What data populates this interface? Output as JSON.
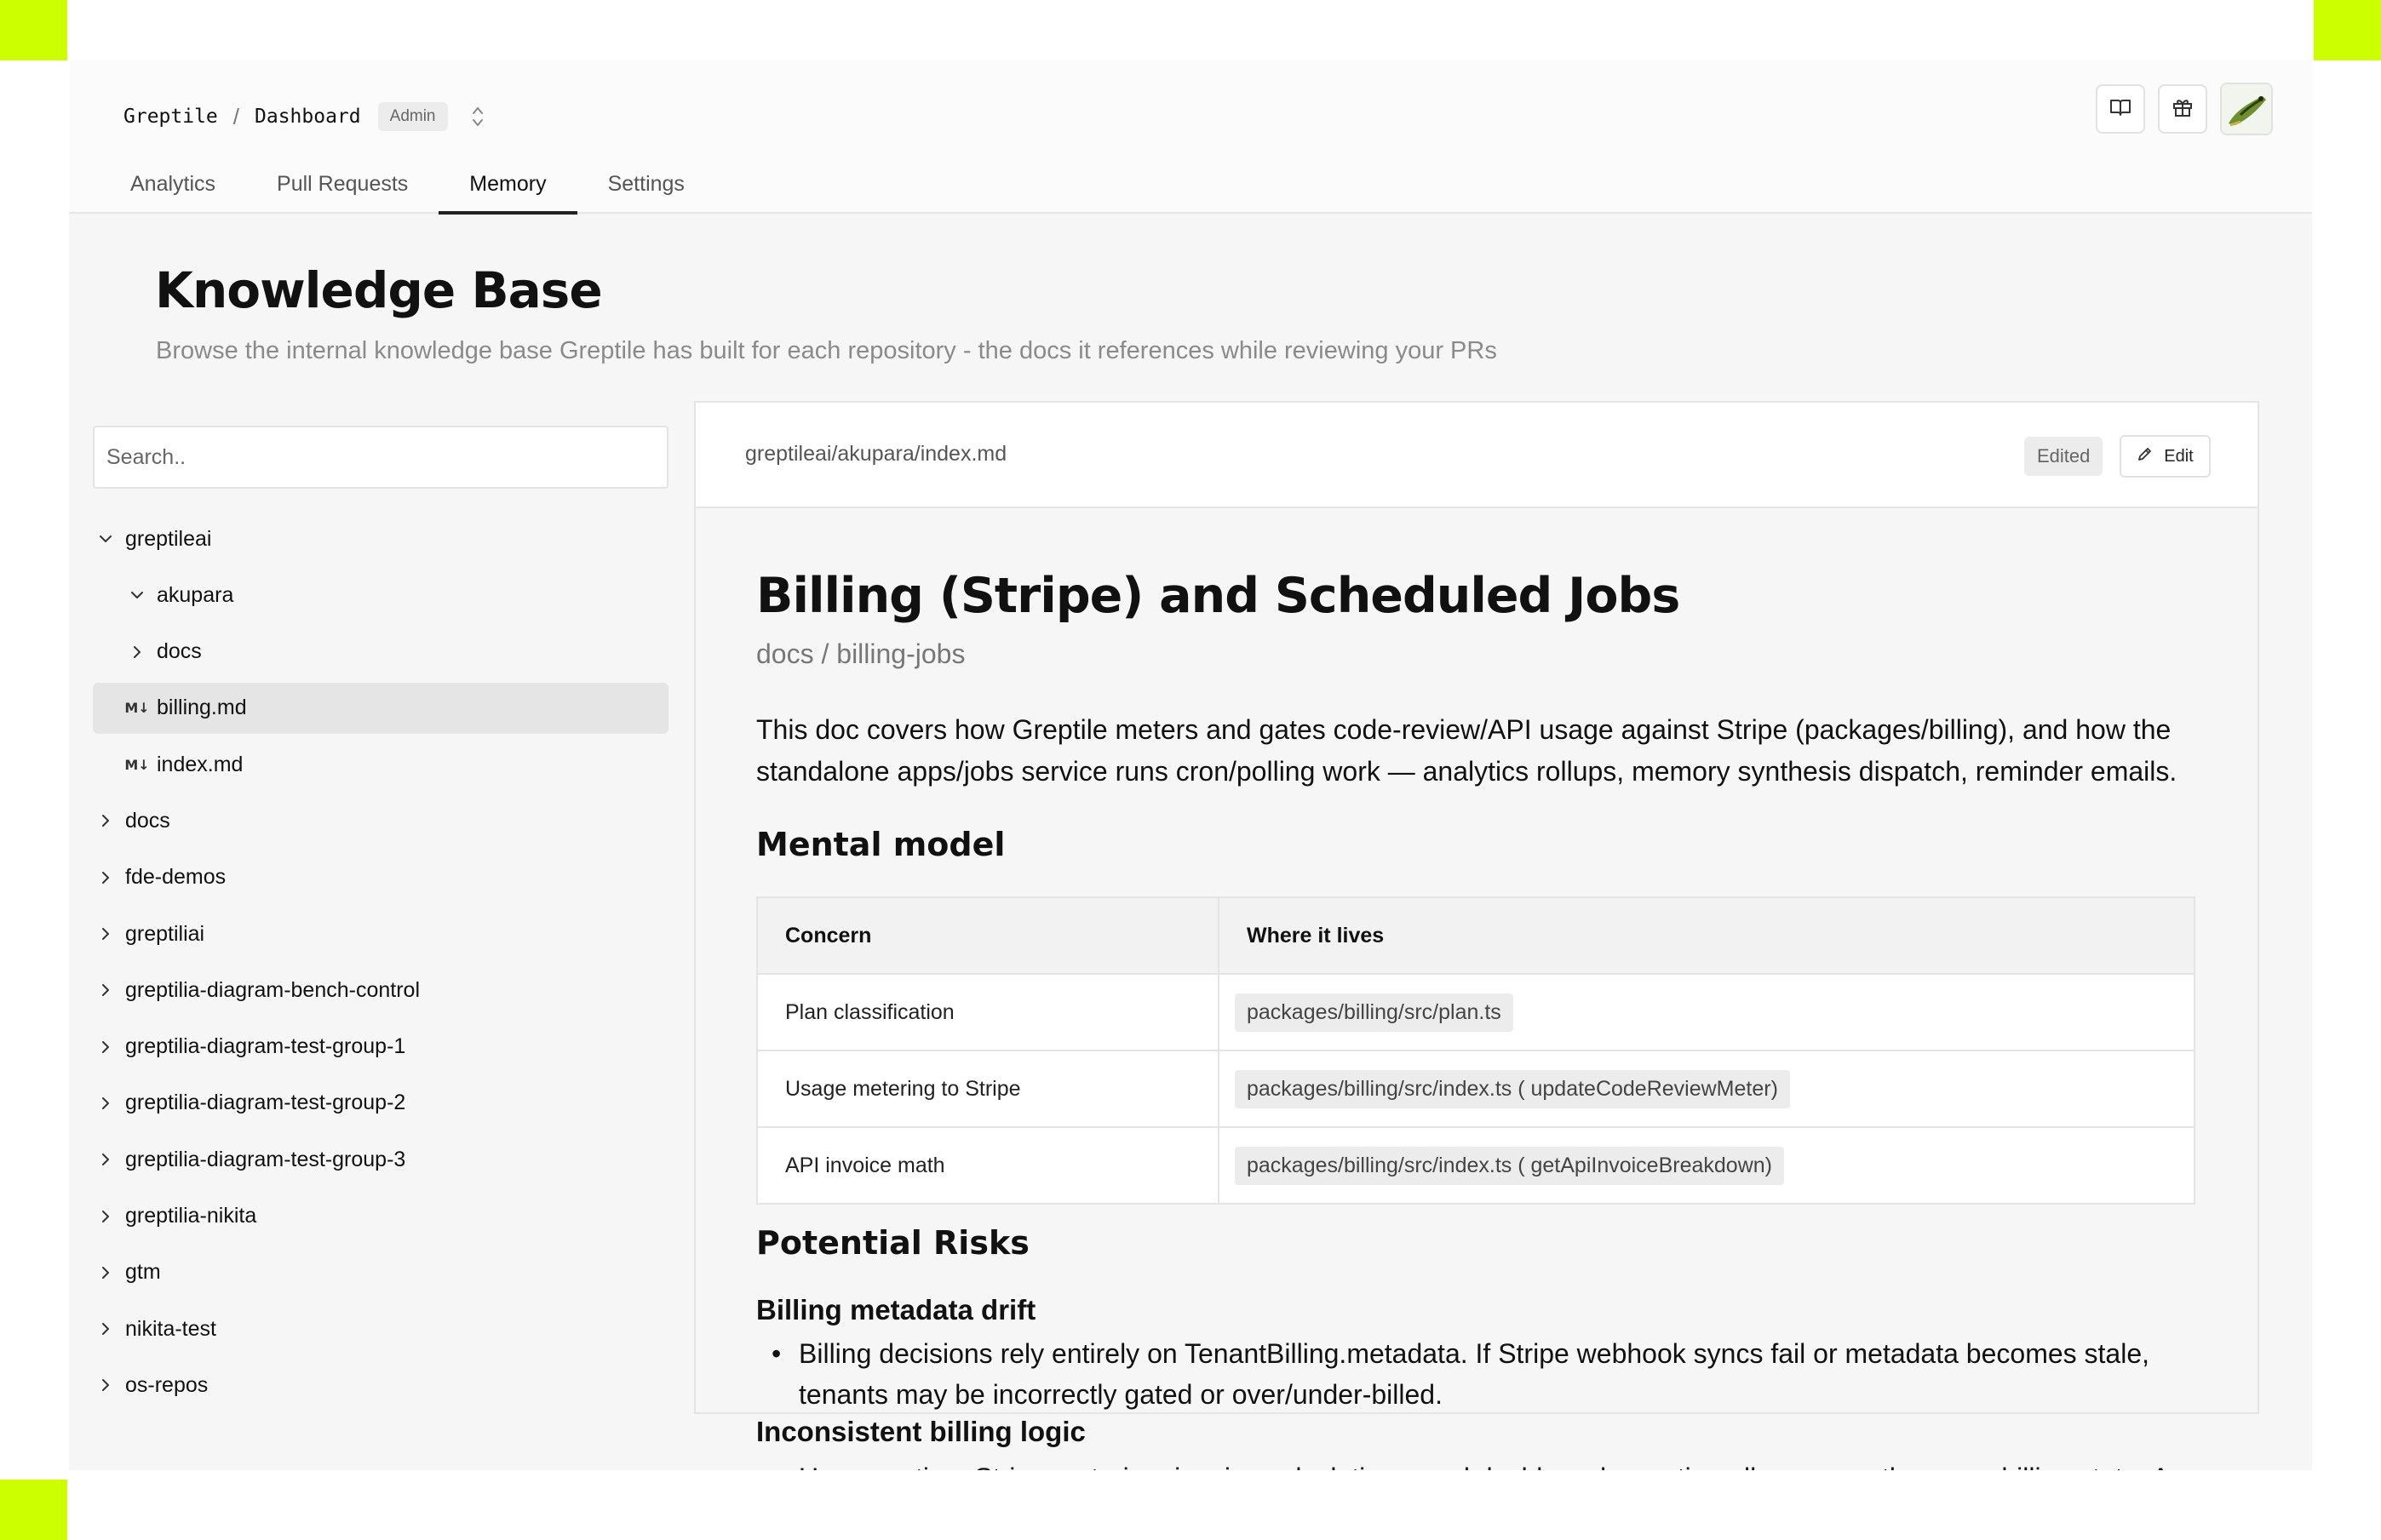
{
  "header": {
    "org": "Greptile",
    "separator": "/",
    "page": "Dashboard",
    "badge": "Admin",
    "icons": [
      "book-icon",
      "gift-icon",
      "avatar"
    ]
  },
  "tabs": [
    {
      "label": "Analytics",
      "active": false
    },
    {
      "label": "Pull Requests",
      "active": false
    },
    {
      "label": "Memory",
      "active": true
    },
    {
      "label": "Settings",
      "active": false
    }
  ],
  "page": {
    "title": "Knowledge Base",
    "subtitle": "Browse the internal knowledge base Greptile has built for each repository - the docs it references while reviewing your PRs"
  },
  "sidebar": {
    "search_placeholder": "Search..",
    "tree": [
      {
        "label": "greptileai",
        "expanded": true
      },
      {
        "label": "akupara",
        "expanded": true
      },
      {
        "label": "docs",
        "expanded": false
      },
      {
        "label": "billing.md",
        "selected": true,
        "icon": "M↓"
      },
      {
        "label": "index.md",
        "icon": "M↓"
      },
      {
        "label": "docs"
      },
      {
        "label": "fde-demos"
      },
      {
        "label": "greptiliai"
      },
      {
        "label": "greptilia-diagram-bench-control"
      },
      {
        "label": "greptilia-diagram-test-group-1"
      },
      {
        "label": "greptilia-diagram-test-group-2"
      },
      {
        "label": "greptilia-diagram-test-group-3"
      },
      {
        "label": "greptilia-nikita"
      },
      {
        "label": "gtm"
      },
      {
        "label": "nikita-test"
      },
      {
        "label": "os-repos"
      }
    ]
  },
  "doc": {
    "path": "greptileai/akupara/index.md",
    "status": "Edited",
    "edit_label": "Edit",
    "title": "Billing (Stripe) and Scheduled Jobs",
    "subtitle": "docs / billing-jobs",
    "intro": "This doc covers how Greptile meters and gates code-review/API usage against Stripe (packages/billing), and how the standalone apps/jobs service runs cron/polling work — analytics rollups, memory synthesis dispatch, reminder emails.",
    "mental_model_heading": "Mental model",
    "table": {
      "headers": [
        "Concern",
        "Where it lives"
      ],
      "rows": [
        [
          "Plan classification",
          "packages/billing/src/plan.ts"
        ],
        [
          "Usage metering to Stripe",
          "packages/billing/src/index.ts ( updateCodeReviewMeter)"
        ],
        [
          "API invoice math",
          "packages/billing/src/index.ts ( getApiInvoiceBreakdown)"
        ]
      ]
    },
    "risks_heading": "Potential Risks",
    "risk1_title": "Billing metadata drift",
    "risk1_text": "Billing decisions rely entirely on TenantBilling.metadata. If Stripe webhook syncs fail or metadata becomes stale, tenants may be incorrectly gated or over/under-billed.",
    "risk2_title": "Inconsistent billing logic",
    "risk2_text": "Usage gating, Stripe metering, invoice calculations, and dashboard reporting all consume the same billing state. Any"
  }
}
